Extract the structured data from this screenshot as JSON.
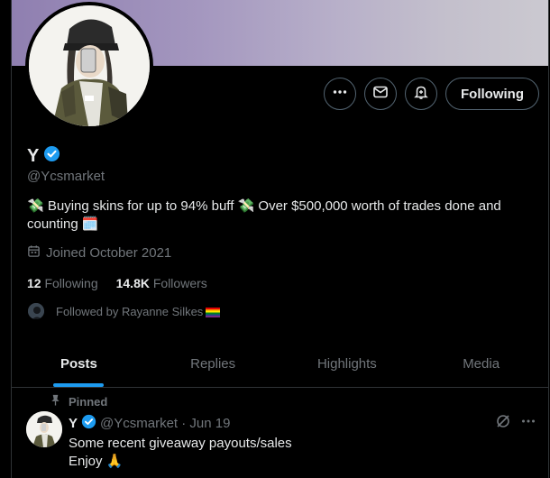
{
  "profile": {
    "display_name": "Y",
    "handle": "@Ycsmarket",
    "bio_part1": "Buying skins for up to 94% buff",
    "bio_part2": "Over $500,000 worth of trades done and counting",
    "joined": "Joined October 2021",
    "following_count": "12",
    "following_label": "Following",
    "followers_count": "14.8K",
    "followers_label": "Followers",
    "followed_by": "Followed by Rayanne Silkes"
  },
  "actions": {
    "follow_label": "Following"
  },
  "tabs": [
    {
      "label": "Posts"
    },
    {
      "label": "Replies"
    },
    {
      "label": "Highlights"
    },
    {
      "label": "Media"
    }
  ],
  "post": {
    "pinned_label": "Pinned",
    "name": "Y",
    "meta": "@Ycsmarket · Jun 19",
    "line1": "Some recent giveaway payouts/sales",
    "line2": "Enjoy"
  },
  "colors": {
    "accent": "#1d9bf0",
    "verified": "#1d9bf0",
    "muted": "#71767b",
    "border": "#2f3336"
  },
  "icons": {
    "more": "more-icon",
    "message": "message-icon",
    "notify": "bell-plus-icon",
    "verified": "verified-badge-icon",
    "calendar": "calendar-icon",
    "pin": "pin-icon",
    "grok": "grok-icon"
  }
}
